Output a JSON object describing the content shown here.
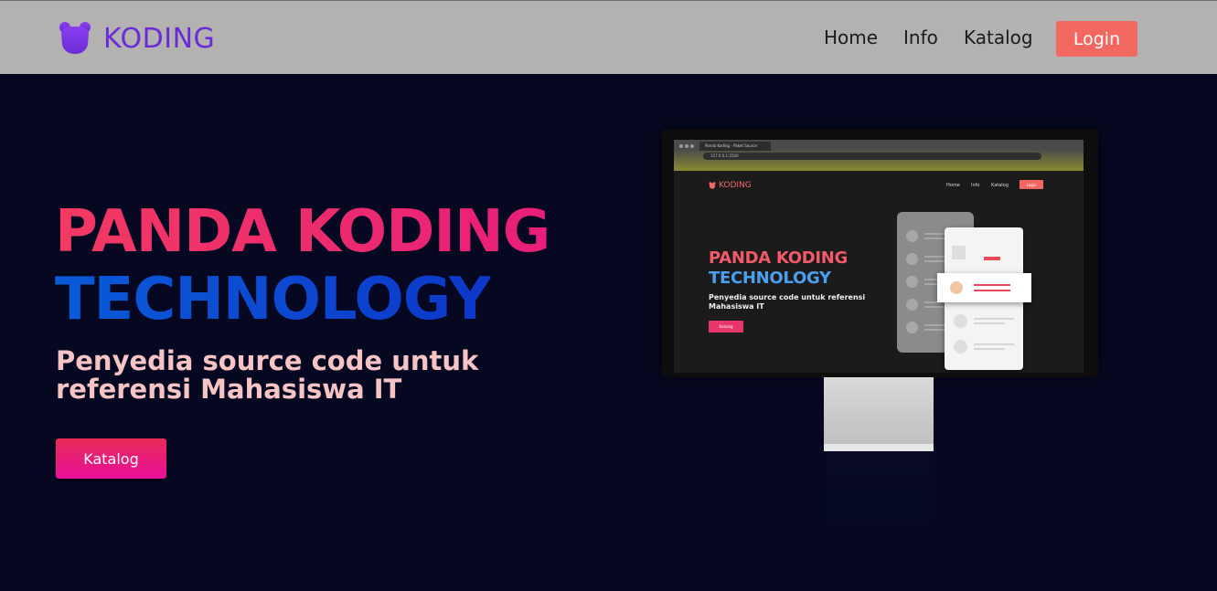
{
  "navbar": {
    "brand": "KODING",
    "links": [
      "Home",
      "Info",
      "Katalog"
    ],
    "login_label": "Login"
  },
  "hero": {
    "title_line1": "PANDA KODING",
    "title_line2": "TECHNOLOGY",
    "subtitle": "Penyedia source code untuk referensi Mahasiswa IT",
    "cta_label": "Katalog"
  },
  "mockup": {
    "tab_title": "Panda Koding - Paket Source",
    "url": "127.0.0.1:5500",
    "brand": "KODING",
    "links": [
      "Home",
      "Info",
      "Katalog"
    ],
    "login_label": "Login",
    "title_line1": "PANDA KODING",
    "title_line2": "TECHNOLOGY",
    "subtitle": "Penyedia source code untuk referensi Mahasiswa IT",
    "cta_label": "Katalog"
  },
  "colors": {
    "navbar_bg": "#b3b2b0",
    "brand": "#6a2bd6",
    "login_bg": "#f2675f",
    "page_bg": "#050820",
    "title_red": "#f23a62",
    "title_blue": "#0a5bd8",
    "subtitle": "#f6c4c4",
    "cta": "#e82a56"
  }
}
